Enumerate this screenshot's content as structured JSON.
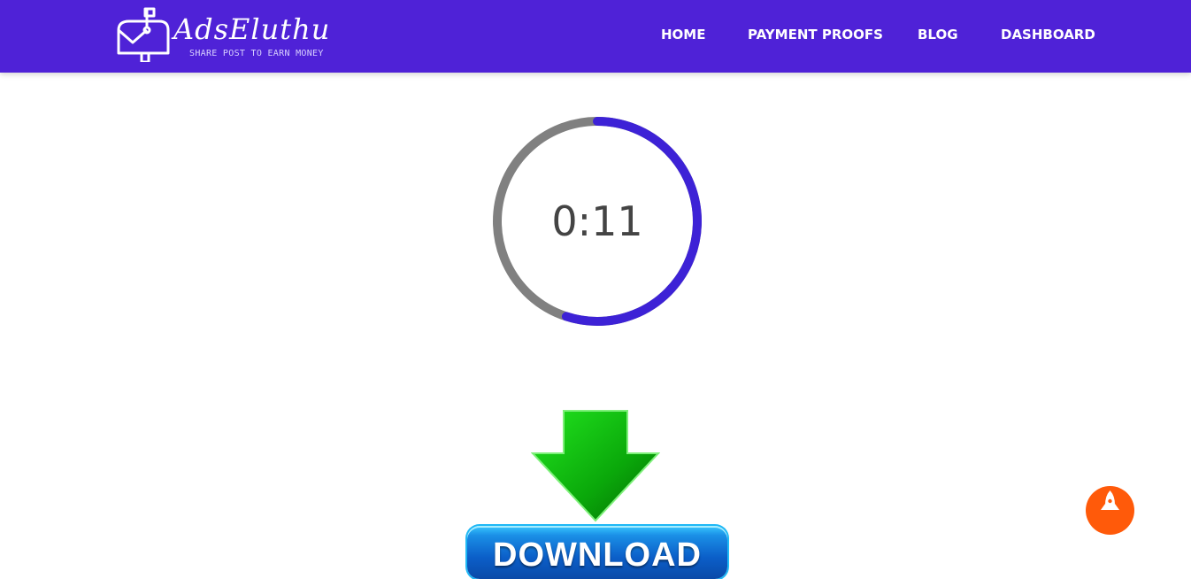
{
  "brand": {
    "name": "AdsEluthu",
    "tagline": "SHARE POST TO EARN MONEY",
    "logo_icon": "mailbox-icon"
  },
  "nav": {
    "items": [
      {
        "label": "HOME"
      },
      {
        "label": "PAYMENT PROOFS"
      },
      {
        "label": "BLOG"
      },
      {
        "label": "DASHBOARD"
      }
    ]
  },
  "timer": {
    "display": "0:11",
    "progress_fraction": 0.55,
    "progress_color": "#3d22d6",
    "track_color": "#808080"
  },
  "download": {
    "label": "DOWNLOAD",
    "arrow_icon": "down-arrow-icon"
  },
  "scroll_top": {
    "icon": "rocket-icon",
    "color": "#ff5a0a"
  },
  "colors": {
    "navbar": "#4f22d7",
    "background": "#ffffff"
  }
}
